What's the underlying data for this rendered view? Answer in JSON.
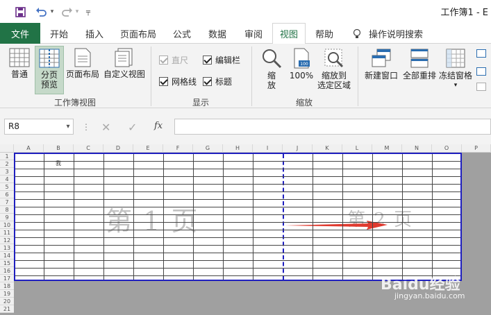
{
  "title_bar": {
    "doc_title": "工作簿1 - E"
  },
  "tabs": {
    "file": "文件",
    "items": [
      "开始",
      "插入",
      "页面布局",
      "公式",
      "数据",
      "审阅",
      "视图",
      "帮助"
    ],
    "active": "视图",
    "tell_me": "操作说明搜索"
  },
  "ribbon": {
    "workbook_views": {
      "label": "工作簿视图",
      "normal": "普通",
      "page_break_line1": "分页",
      "page_break_line2": "预览",
      "page_layout": "页面布局",
      "custom_views": "自定义视图"
    },
    "show": {
      "label": "显示",
      "ruler": "直尺",
      "formula_bar": "编辑栏",
      "gridlines": "网格线",
      "headings": "标题",
      "ruler_checked": true,
      "formula_bar_checked": true,
      "gridlines_checked": true,
      "headings_checked": true
    },
    "zoom": {
      "label": "缩放",
      "zoom_line1": "缩",
      "zoom_line2": "放",
      "hundred": "100%",
      "to_selection_line1": "缩放到",
      "to_selection_line2": "选定区域"
    },
    "window": {
      "new_window": "新建窗口",
      "arrange_all": "全部重排",
      "freeze_panes": "冻结窗格"
    }
  },
  "formula_bar": {
    "name_box": "R8",
    "fx": "fx",
    "value": ""
  },
  "sheet": {
    "columns": [
      "A",
      "B",
      "C",
      "D",
      "E",
      "F",
      "G",
      "H",
      "I",
      "J",
      "K",
      "L",
      "M",
      "N",
      "O",
      "P"
    ],
    "rows": [
      "1",
      "2",
      "3",
      "4",
      "5",
      "6",
      "7",
      "8",
      "9",
      "10",
      "11",
      "12",
      "13",
      "14",
      "15",
      "16",
      "17",
      "18",
      "19",
      "20",
      "21"
    ],
    "cell_b2": "我",
    "page1": "第 1 页",
    "page2": "第 2 页"
  },
  "watermark": {
    "brand": "Baidu经验",
    "url": "jingyan.baidu.com"
  },
  "colors": {
    "accent": "#217346",
    "page_border": "#1f1fbf",
    "arrow": "#e03a2f"
  }
}
